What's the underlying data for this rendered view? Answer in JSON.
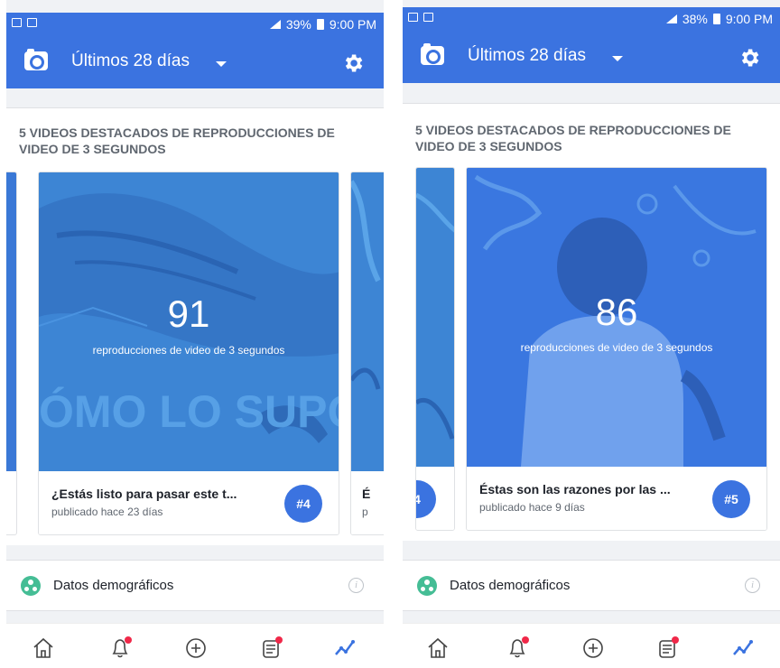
{
  "screens": [
    {
      "status": {
        "battery": "39%",
        "time": "9:00 PM"
      },
      "header": {
        "period": "Últimos 28 días"
      },
      "section_title": "5 VIDEOS DESTACADOS DE REPRODUCCIONES DE VIDEO DE 3 SEGUNDOS",
      "card": {
        "count": "91",
        "metric": "reproducciones de video de 3 segundos",
        "thumb_text": "ÓMO LO SUPO?",
        "title": "¿Estás listo para pasar este t...",
        "subtitle": "publicado hace 23 días",
        "rank": "#4"
      },
      "next_card": {
        "title_peek": "É",
        "subtitle_peek": "p"
      },
      "demographics_label": "Datos demográficos"
    },
    {
      "status": {
        "battery": "38%",
        "time": "9:00 PM"
      },
      "header": {
        "period": "Últimos 28 días"
      },
      "section_title": "5 VIDEOS DESTACADOS DE REPRODUCCIONES DE VIDEO DE 3 SEGUNDOS",
      "prev_card": {
        "rank_peek": "4"
      },
      "card": {
        "count": "86",
        "metric": "reproducciones de video de 3 segundos",
        "title": "Éstas son las razones por las ...",
        "subtitle": "publicado hace 9 días",
        "rank": "#5"
      },
      "demographics_label": "Datos demográficos"
    }
  ],
  "icons": {
    "status_left": [
      "image-icon",
      "message-icon"
    ],
    "header": [
      "camera-icon",
      "caret-down-icon",
      "gear-icon"
    ],
    "bottom_nav": [
      "home-icon",
      "bell-icon",
      "plus-circle-icon",
      "feed-icon",
      "insights-icon"
    ]
  },
  "colors": {
    "brand_blue": "#3b73e0",
    "notification_red": "#f02849",
    "demographics_green": "#45bd95"
  }
}
